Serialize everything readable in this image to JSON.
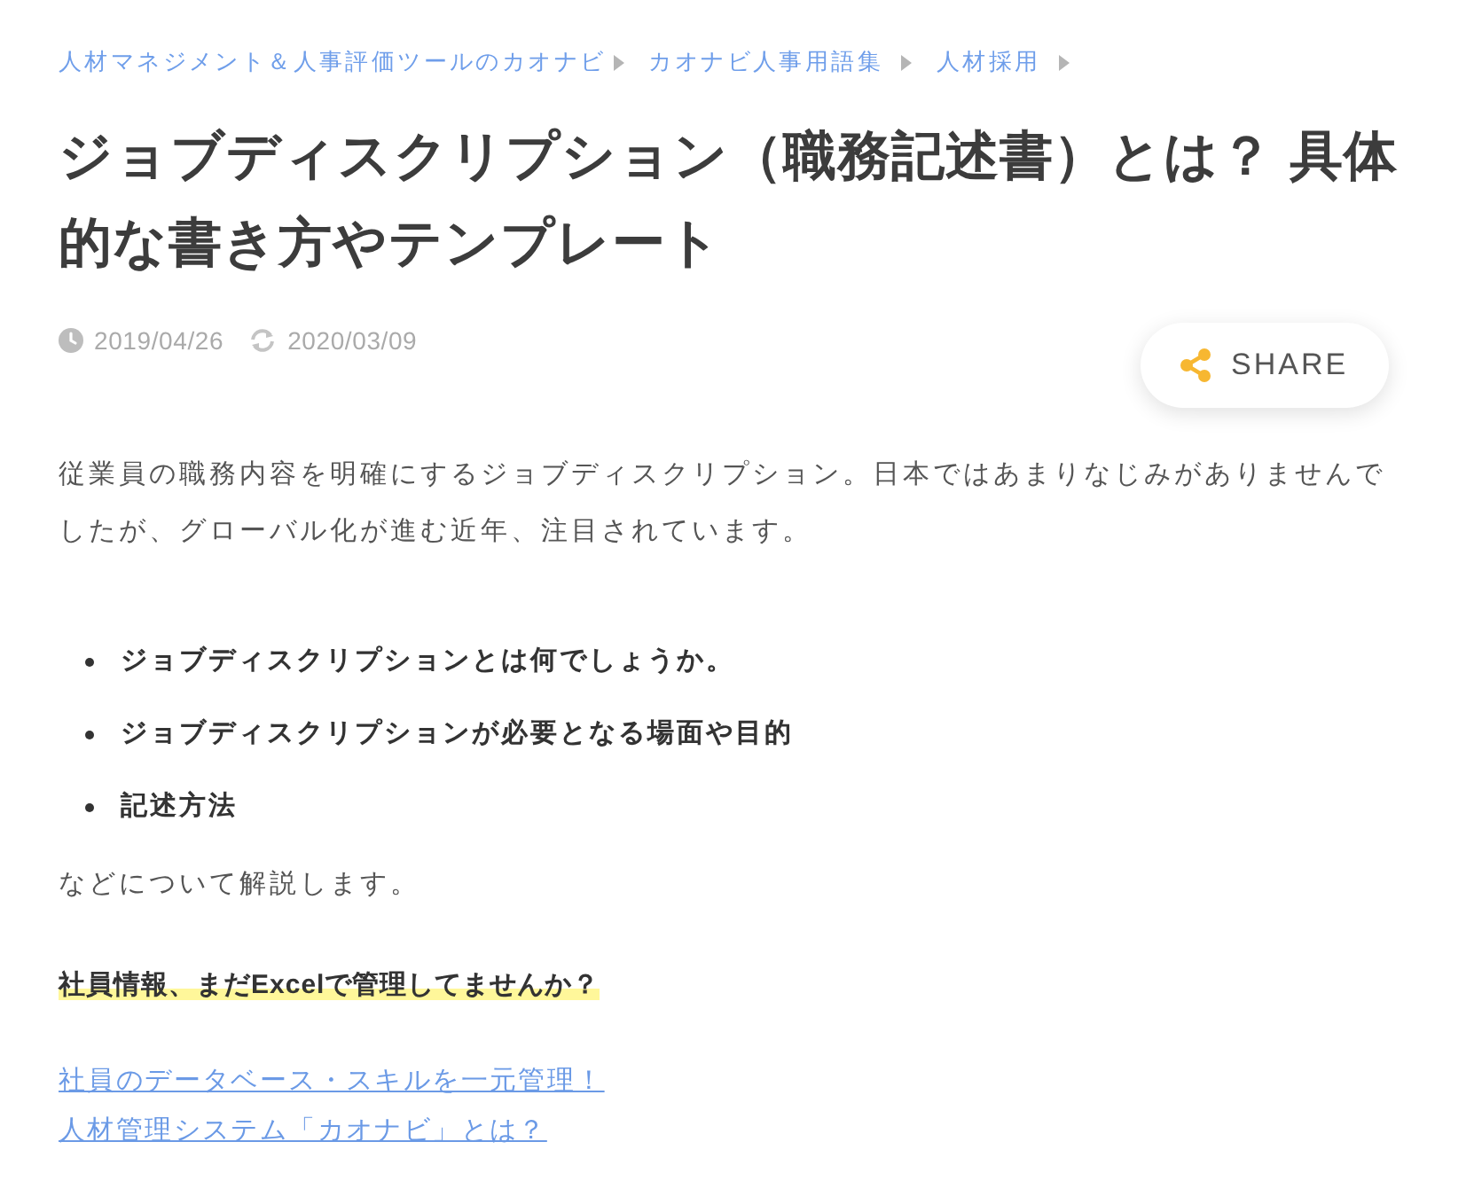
{
  "breadcrumb": [
    {
      "label": "人材マネジメント＆人事評価ツールのカオナビ"
    },
    {
      "label": "カオナビ人事用語集"
    },
    {
      "label": "人材採用"
    }
  ],
  "title": "ジョブディスクリプション（職務記述書）とは？ 具体的な書き方やテンプレート",
  "dates": {
    "published": "2019/04/26",
    "updated": "2020/03/09"
  },
  "share_button": {
    "label": "SHARE"
  },
  "intro": "従業員の職務内容を明確にするジョブディスクリプション。日本ではあまりなじみがありませんでしたが、グローバル化が進む近年、注目されています。",
  "bullets": [
    "ジョブディスクリプションとは何でしょうか。",
    "ジョブディスクリプションが必要となる場面や目的",
    "記述方法"
  ],
  "outro": "などについて解説します。",
  "callout": "社員情報、まだExcelで管理してませんか？",
  "links": [
    "社員のデータベース・スキルを一元管理！",
    "人材管理システム「カオナビ」とは？"
  ]
}
